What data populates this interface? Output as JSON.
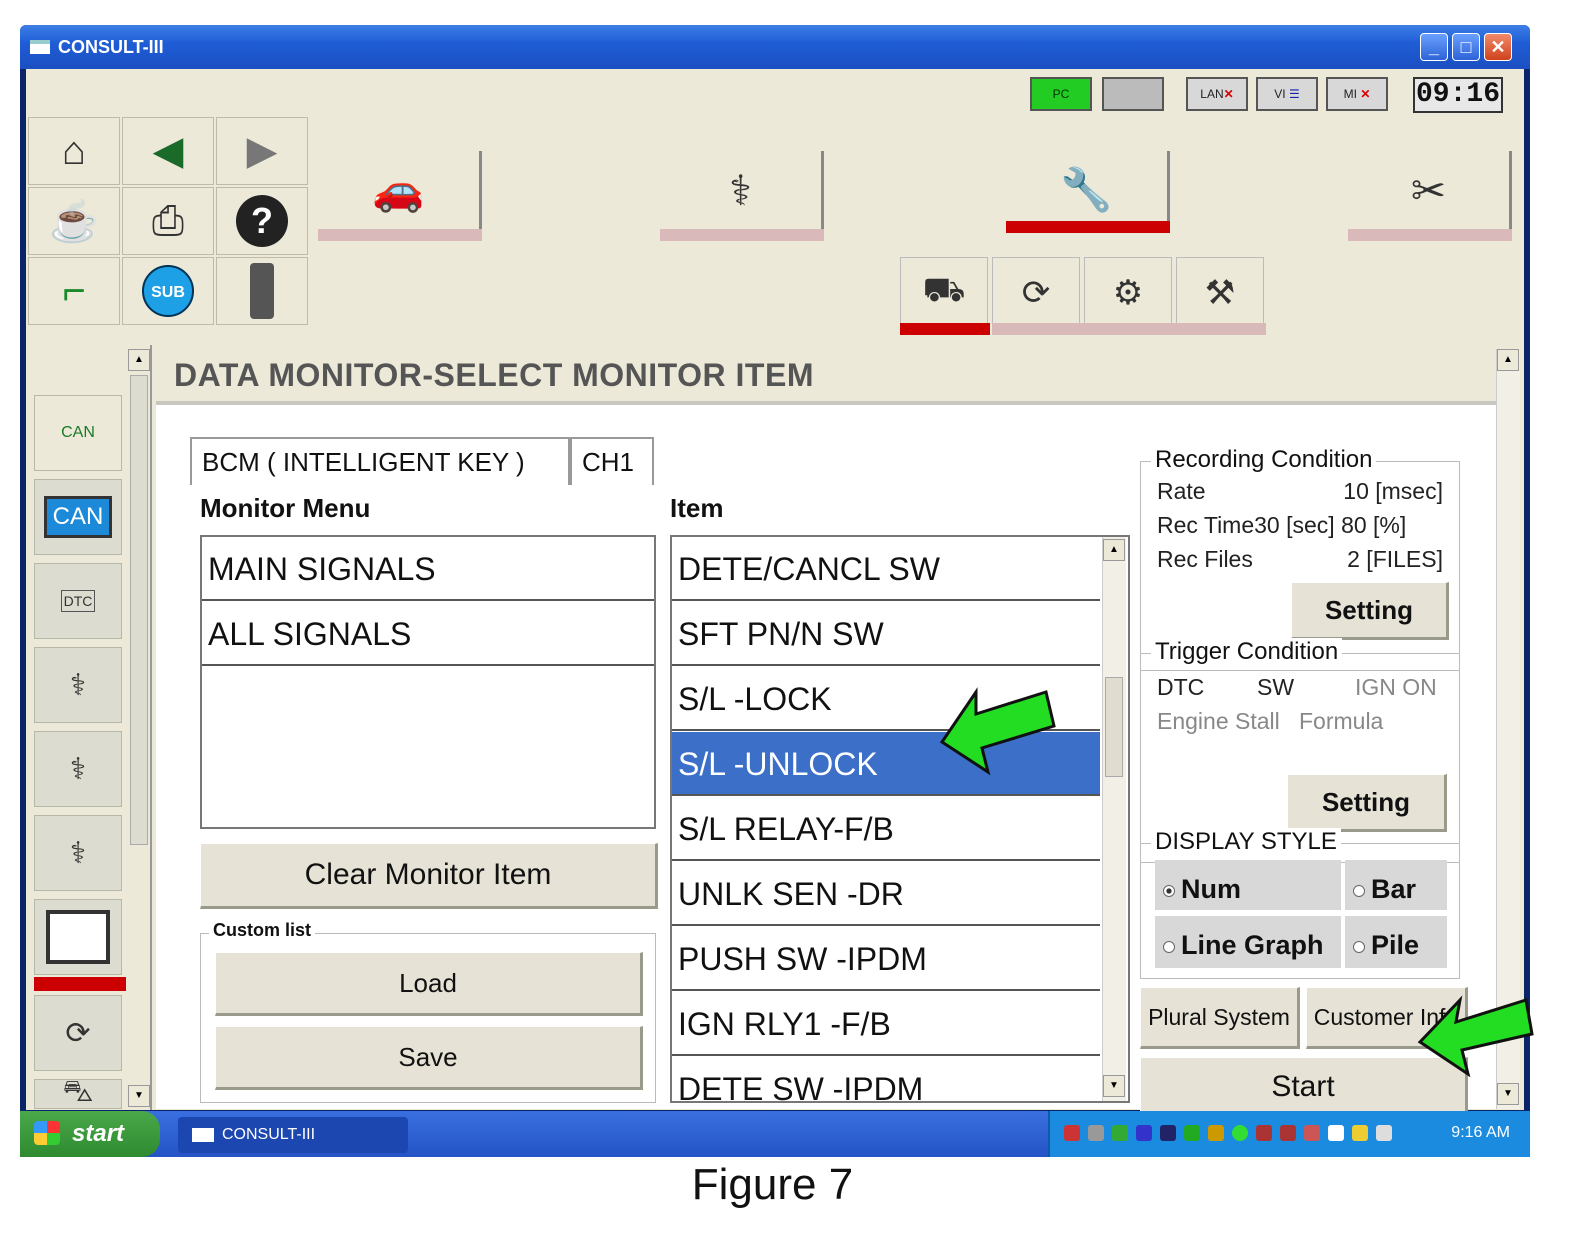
{
  "window": {
    "title": "CONSULT-III"
  },
  "status": {
    "pc": "PC",
    "lan": "LAN",
    "vi": "VI",
    "mi": "MI",
    "clock": "09:16"
  },
  "toolbar": {
    "home_icon": "home-icon",
    "sub_label": "SUB",
    "help_label": "?"
  },
  "sidebar": {
    "can_label": "CAN",
    "can_bus_label": "CAN",
    "dtc_label": "DTC"
  },
  "page": {
    "title": "DATA MONITOR-SELECT MONITOR ITEM"
  },
  "tabs": [
    {
      "label": "BCM ( INTELLIGENT KEY )"
    },
    {
      "label": "CH1"
    }
  ],
  "monitor_menu": {
    "header": "Monitor Menu",
    "items": [
      "MAIN SIGNALS",
      "ALL SIGNALS"
    ]
  },
  "item_list": {
    "header": "Item",
    "items": [
      "DETE/CANCL SW",
      "SFT PN/N SW",
      "S/L -LOCK",
      "S/L -UNLOCK",
      "S/L RELAY-F/B",
      "UNLK SEN -DR",
      "PUSH SW -IPDM",
      "IGN RLY1 -F/B",
      "DETE SW -IPDM"
    ],
    "selected": "S/L -UNLOCK"
  },
  "buttons": {
    "clear": "Clear Monitor Item",
    "custom_list": "Custom list",
    "load": "Load",
    "save": "Save",
    "setting": "Setting",
    "plural": "Plural System",
    "customer": "Customer Info",
    "start": "Start"
  },
  "recording": {
    "label": "Recording Condition",
    "rate_label": "Rate",
    "rate_value": "10 [msec]",
    "rec_time": "Rec Time30 [sec] 80 [%]",
    "rec_files_label": "Rec Files",
    "rec_files_value": "2 [FILES]"
  },
  "trigger": {
    "label": "Trigger Condition",
    "dtc": "DTC",
    "sw": "SW",
    "ign": "IGN ON",
    "engine_stall": "Engine Stall",
    "formula": "Formula"
  },
  "display_style": {
    "label": "DISPLAY STYLE",
    "options": [
      "Num",
      "Bar",
      "Line Graph",
      "Pile"
    ],
    "selected": "Num"
  },
  "taskbar": {
    "start": "start",
    "task": "CONSULT-III",
    "time": "9:16 AM"
  },
  "caption": "Figure 7",
  "colors": {
    "selection": "#3b6fc8",
    "active_bar": "#cc0000",
    "arrow": "#22dd22"
  }
}
